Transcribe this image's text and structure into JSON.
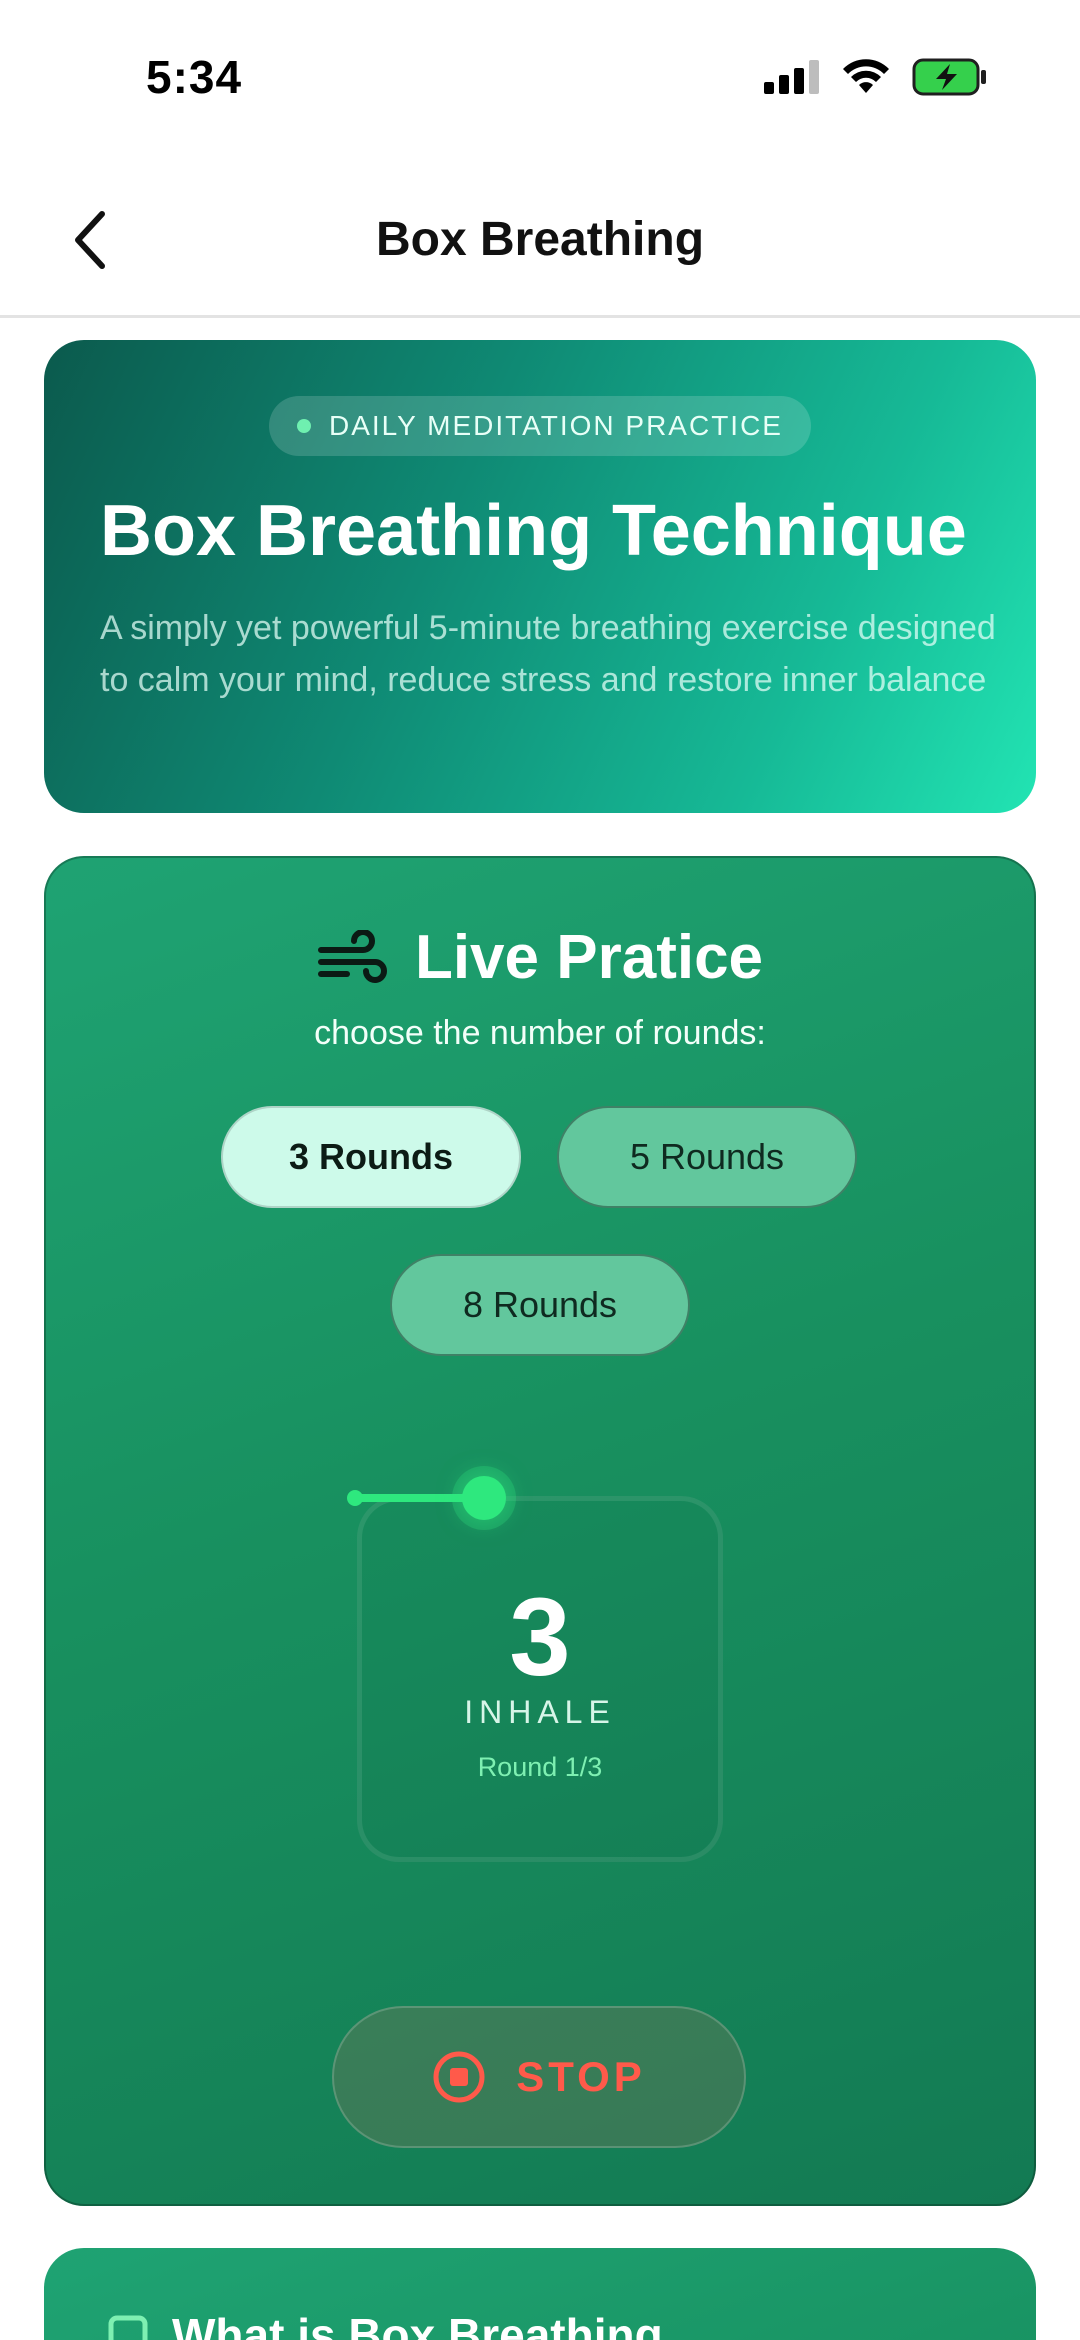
{
  "status_bar": {
    "time": "5:34",
    "icons": [
      "cellular-signal-icon",
      "wifi-icon",
      "battery-charging-icon"
    ]
  },
  "nav": {
    "title": "Box Breathing",
    "back_icon": "chevron-left-icon"
  },
  "hero": {
    "badge": "DAILY MEDITATION PRACTICE",
    "title": "Box Breathing Technique",
    "description": "A simply yet powerful 5-minute breathing exercise designed to calm your mind, reduce stress and restore inner balance"
  },
  "practice": {
    "icon": "wind-icon",
    "title": "Live Pratice",
    "subtitle": "choose the number of rounds:",
    "rounds": [
      {
        "label": "3 Rounds",
        "selected": true
      },
      {
        "label": "5 Rounds",
        "selected": false
      },
      {
        "label": "8 Rounds",
        "selected": false
      }
    ],
    "counter": "3",
    "phase": "INHALE",
    "round_progress": "Round 1/3",
    "stop_label": "STOP"
  },
  "info": {
    "title": "What is Box Breathing",
    "icon": "checkbox-icon"
  },
  "colors": {
    "accent_green": "#2ee87e",
    "stop_red": "#ff5a4a",
    "card_green": "#18905f"
  }
}
